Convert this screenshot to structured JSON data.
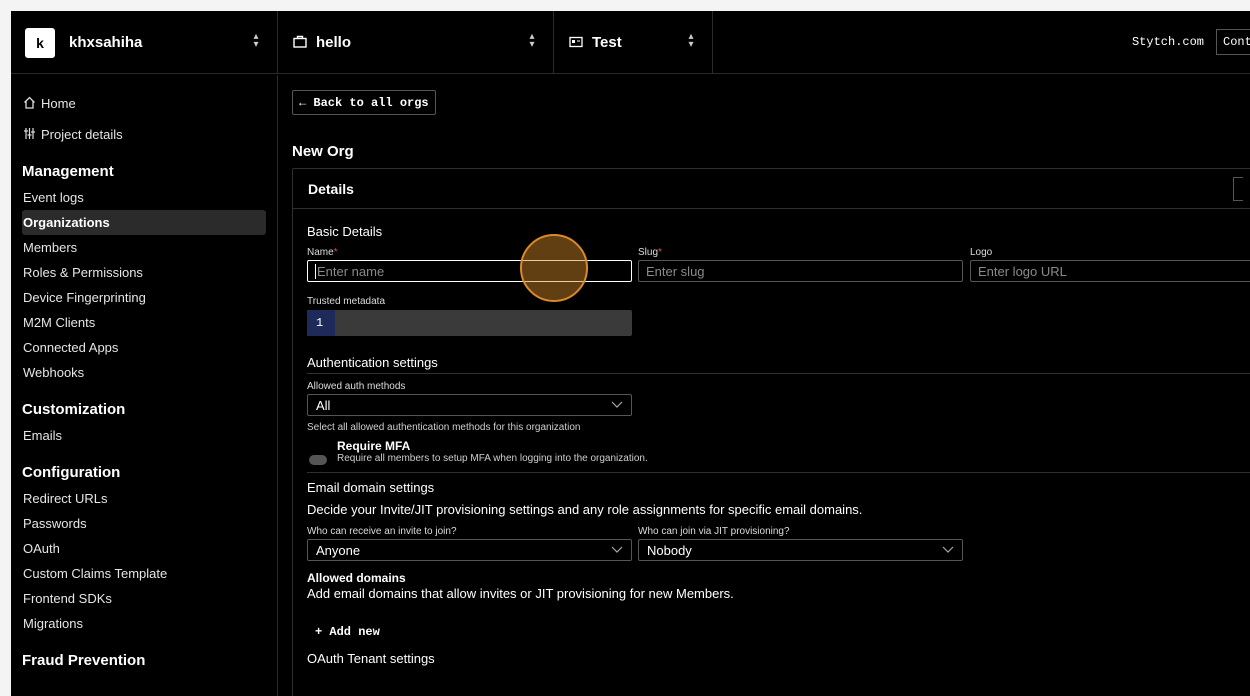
{
  "topbar": {
    "org": {
      "avatar_letter": "k",
      "name": "khxsahiha"
    },
    "project": {
      "icon": "briefcase-icon",
      "name": "hello"
    },
    "environment": {
      "icon": "id-card-icon",
      "name": "Test"
    },
    "stytch_link": "Stytch.com",
    "contact_button": "Cont"
  },
  "sidebar": {
    "top_items": [
      {
        "icon": "home-icon",
        "label": "Home"
      },
      {
        "icon": "sliders-icon",
        "label": "Project details"
      }
    ],
    "management": {
      "heading": "Management",
      "items": [
        "Event logs",
        "Organizations",
        "Members",
        "Roles & Permissions",
        "Device Fingerprinting",
        "M2M Clients",
        "Connected Apps",
        "Webhooks"
      ],
      "active": "Organizations"
    },
    "customization": {
      "heading": "Customization",
      "items": [
        "Emails"
      ]
    },
    "configuration": {
      "heading": "Configuration",
      "items": [
        "Redirect URLs",
        "Passwords",
        "OAuth",
        "Custom Claims Template",
        "Frontend SDKs",
        "Migrations"
      ]
    },
    "fraud": {
      "heading": "Fraud Prevention"
    }
  },
  "main": {
    "back_label": "← Back to all orgs",
    "page_title": "New Org",
    "card_title": "Details",
    "basic": {
      "title": "Basic Details",
      "name_label": "Name",
      "name_placeholder": "Enter name",
      "slug_label": "Slug",
      "slug_placeholder": "Enter slug",
      "logo_label": "Logo",
      "logo_placeholder": "Enter logo URL",
      "required_mark": "*",
      "metadata_label": "Trusted metadata",
      "metadata_line": "1"
    },
    "auth": {
      "title": "Authentication settings",
      "methods_label": "Allowed auth methods",
      "methods_value": "All",
      "methods_hint": "Select all allowed authentication methods for this organization",
      "mfa_title": "Require MFA",
      "mfa_desc": "Require all members to setup MFA when logging into the organization."
    },
    "email": {
      "title": "Email domain settings",
      "desc": "Decide your Invite/JIT provisioning settings and any role assignments for specific email domains.",
      "invite_label": "Who can receive an invite to join?",
      "invite_value": "Anyone",
      "jit_label": "Who can join via JIT provisioning?",
      "jit_value": "Nobody",
      "allowed_title": "Allowed domains",
      "allowed_desc": "Add email domains that allow invites or JIT provisioning for new Members.",
      "add_new": "+ Add new"
    },
    "oauth": {
      "title": "OAuth Tenant settings"
    }
  }
}
